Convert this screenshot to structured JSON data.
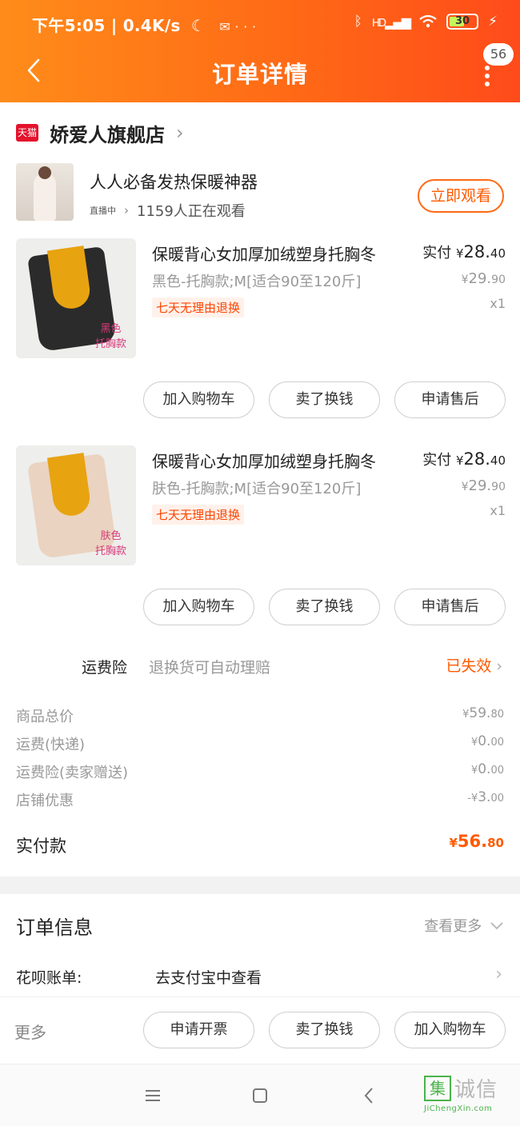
{
  "status_bar": {
    "time": "下午5:05",
    "speed": "0.4K/s",
    "hd_label": "HD",
    "battery": "30"
  },
  "header": {
    "title": "订单详情",
    "message_count": "56"
  },
  "store": {
    "badge": "天猫",
    "name": "娇爱人旗舰店"
  },
  "live": {
    "title": "人人必备发热保暖神器",
    "tag": "直播中",
    "viewers": "1159人正在观看",
    "watch_button": "立即观看"
  },
  "products": [
    {
      "title": "保暖背心女加厚加绒塑身托胸冬",
      "spec": "黑色-托胸款;M[适合90至120斤]",
      "tag": "七天无理由退换",
      "paid_label": "实付",
      "paid_currency": "¥",
      "paid_int": "28.",
      "paid_dec": "40",
      "orig_currency": "¥",
      "orig_int": "29.",
      "orig_dec": "90",
      "qty": "x1",
      "image_label_1": "黑色",
      "image_label_2": "托胸款",
      "buttons": [
        "加入购物车",
        "卖了换钱",
        "申请售后"
      ]
    },
    {
      "title": "保暖背心女加厚加绒塑身托胸冬",
      "spec": "肤色-托胸款;M[适合90至120斤]",
      "tag": "七天无理由退换",
      "paid_label": "实付",
      "paid_currency": "¥",
      "paid_int": "28.",
      "paid_dec": "40",
      "orig_currency": "¥",
      "orig_int": "29.",
      "orig_dec": "90",
      "qty": "x1",
      "image_label_1": "肤色",
      "image_label_2": "托胸款",
      "buttons": [
        "加入购物车",
        "卖了换钱",
        "申请售后"
      ]
    }
  ],
  "insurance": {
    "label": "运费险",
    "desc": "退换货可自动理赔",
    "status": "已失效"
  },
  "summary": [
    {
      "label": "商品总价",
      "prefix": "¥",
      "int": "59.",
      "dec": "80"
    },
    {
      "label": "运费(快递)",
      "prefix": "¥",
      "int": "0.",
      "dec": "00"
    },
    {
      "label": "运费险(卖家赠送)",
      "prefix": "¥",
      "int": "0.",
      "dec": "00"
    },
    {
      "label": "店铺优惠",
      "prefix": "-¥",
      "int": "3.",
      "dec": "00"
    }
  ],
  "total": {
    "label": "实付款",
    "prefix": "¥",
    "int": "56.",
    "dec": "80"
  },
  "order_info": {
    "title": "订单信息",
    "more": "查看更多",
    "huabei_label": "花呗账单:",
    "huabei_value": "去支付宝中查看"
  },
  "action_bar": {
    "more": "更多",
    "buttons": [
      "申请开票",
      "卖了换钱",
      "加入购物车"
    ]
  },
  "watermark": {
    "box_char": "集",
    "text": "诚信",
    "sub": "JiChengXin.com"
  },
  "colors": {
    "accent": "#ff5a00",
    "header_start": "#ff8c1a",
    "header_end": "#ff4b1a",
    "tmall_red": "#e4122c"
  }
}
